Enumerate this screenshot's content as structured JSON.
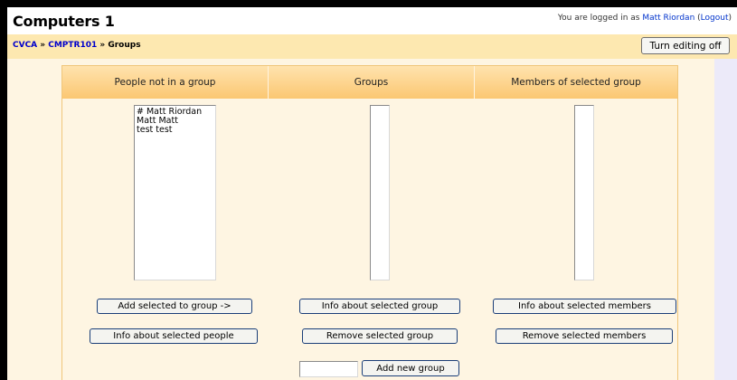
{
  "header": {
    "course_title": "Computers 1",
    "login_prefix": "You are logged in as ",
    "user_name": "Matt Riordan",
    "logout_open": " (",
    "logout_label": "Logout",
    "logout_close": ")"
  },
  "breadcrumb": {
    "items": [
      "CVCA",
      "CMPTR101",
      "Groups"
    ],
    "separator": " » "
  },
  "toolbar": {
    "editing_button": "Turn editing off"
  },
  "columns": {
    "people": {
      "heading": "People not in a group",
      "entries": [
        "# Matt Riordan",
        "Matt Matt",
        "test test"
      ]
    },
    "groups": {
      "heading": "Groups"
    },
    "members": {
      "heading": "Members of selected group"
    }
  },
  "buttons": {
    "add_to_group": "Add selected to group ->",
    "info_people": "Info about selected people",
    "info_group": "Info about selected group",
    "remove_group": "Remove selected group",
    "info_members": "Info about selected members",
    "remove_members": "Remove selected members",
    "add_group": "Add new group"
  },
  "new_group_input": {
    "value": ""
  }
}
